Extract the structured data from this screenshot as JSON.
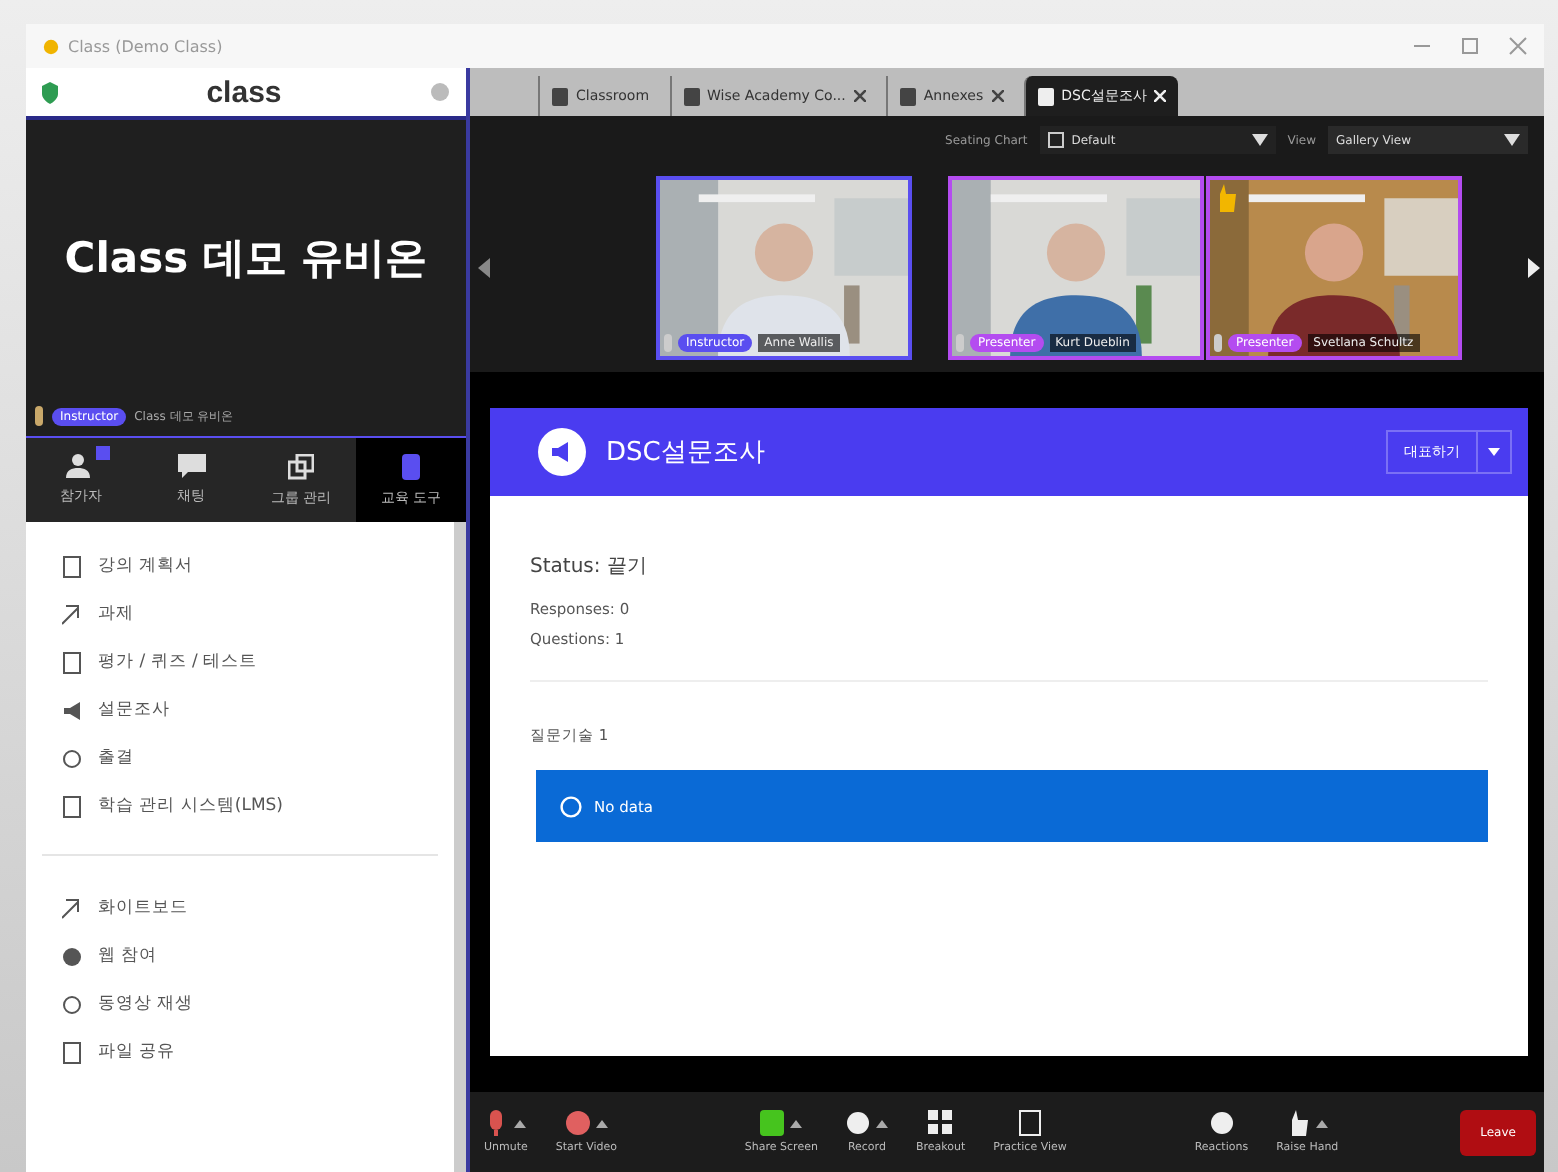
{
  "window": {
    "title": "Class (Demo Class)"
  },
  "sidebar": {
    "logo": "class",
    "room_title": "Class 데모 유비온",
    "host": {
      "badge": "Instructor",
      "name": "Class 데모 유비온"
    },
    "tools": [
      {
        "label": "참가자",
        "selected": false,
        "badge": true
      },
      {
        "label": "채팅",
        "selected": false,
        "badge": false
      },
      {
        "label": "그룹 관리",
        "selected": false,
        "badge": false
      },
      {
        "label": "교육 도구",
        "selected": true,
        "badge": false
      }
    ],
    "sections": [
      {
        "items": [
          {
            "label": "강의 계획서"
          },
          {
            "label": "과제"
          },
          {
            "label": "평가 / 퀴즈 / 테스트"
          },
          {
            "label": "설문조사"
          },
          {
            "label": "출결"
          },
          {
            "label": "학습 관리 시스템(LMS)"
          }
        ]
      },
      {
        "items": [
          {
            "label": "화이트보드"
          },
          {
            "label": "웹 참여"
          },
          {
            "label": "동영상 재생"
          },
          {
            "label": "파일 공유"
          }
        ]
      }
    ]
  },
  "browser_tabs": [
    {
      "label": "Classroom",
      "selected": false
    },
    {
      "label": "Wise Academy Co...",
      "selected": false
    },
    {
      "label": "Annexes",
      "selected": false
    },
    {
      "label": "DSC설문조사",
      "selected": true
    }
  ],
  "view_bar": {
    "seating_label": "Seating Chart",
    "seating_value": "Default",
    "view_label": "View",
    "view_value": "Gallery View"
  },
  "videos": [
    {
      "role": "Instructor",
      "name": "Anne Wallis",
      "color": "#5a4ef0",
      "hand": false
    },
    {
      "role": "Presenter",
      "name": "Kurt Dueblin",
      "color": "#b44cf0",
      "hand": false
    },
    {
      "role": "Presenter",
      "name": "Svetlana Schultz",
      "color": "#b44cf0",
      "hand": true
    }
  ],
  "survey": {
    "title": "DSC설문조사",
    "action": "대표하기",
    "status": "Status: 끝기",
    "responses": "Responses: 0",
    "questions": "Questions: 1",
    "question_label": "질문기술 1",
    "answer": "No data"
  },
  "toolbar": {
    "left": [
      {
        "label": "Unmute",
        "caret": true
      },
      {
        "label": "Start Video",
        "caret": true
      }
    ],
    "center": [
      {
        "label": "Share Screen",
        "caret": true
      },
      {
        "label": "Record",
        "caret": true
      },
      {
        "label": "Breakout",
        "caret": false
      },
      {
        "label": "Practice View",
        "caret": false
      }
    ],
    "right": [
      {
        "label": "Reactions",
        "caret": false
      },
      {
        "label": "Raise Hand",
        "caret": true
      }
    ]
  },
  "leave_button": "Leave"
}
